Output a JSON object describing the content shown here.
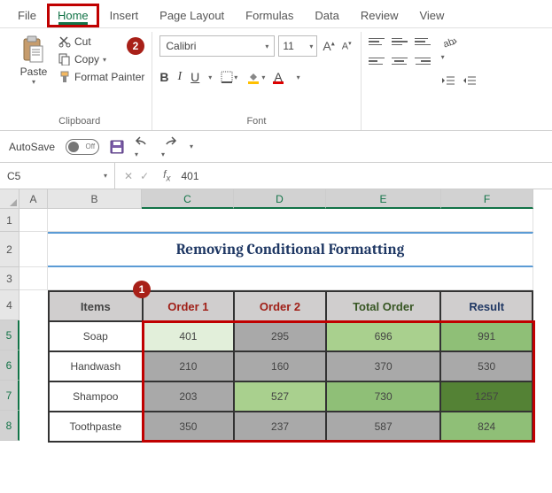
{
  "tabs": {
    "file": "File",
    "home": "Home",
    "insert": "Insert",
    "pagelayout": "Page Layout",
    "formulas": "Formulas",
    "data": "Data",
    "review": "Review",
    "view": "View"
  },
  "ribbon": {
    "clipboard": {
      "paste": "Paste",
      "cut": "Cut",
      "copy": "Copy",
      "painter": "Format Painter",
      "group": "Clipboard"
    },
    "font": {
      "name": "Calibri",
      "size": "11",
      "group": "Font"
    }
  },
  "autosave": {
    "label": "AutoSave",
    "state": "Off"
  },
  "namebox": "C5",
  "formula": "401",
  "badges": {
    "b1": "1",
    "b2": "2"
  },
  "cols": {
    "A": "A",
    "B": "B",
    "C": "C",
    "D": "D",
    "E": "E",
    "F": "F"
  },
  "rows": {
    "r1": "1",
    "r2": "2",
    "r3": "3",
    "r4": "4",
    "r5": "5",
    "r6": "6",
    "r7": "7",
    "r8": "8"
  },
  "title": "Removing Conditional Formatting",
  "headers": {
    "items": "Items",
    "o1": "Order 1",
    "o2": "Order 2",
    "tot": "Total Order",
    "res": "Result"
  },
  "data": {
    "r5": {
      "item": "Soap",
      "o1": "401",
      "o2": "295",
      "tot": "696",
      "res": "991"
    },
    "r6": {
      "item": "Handwash",
      "o1": "210",
      "o2": "160",
      "tot": "370",
      "res": "530"
    },
    "r7": {
      "item": "Shampoo",
      "o1": "203",
      "o2": "527",
      "tot": "730",
      "res": "1257"
    },
    "r8": {
      "item": "Toothpaste",
      "o1": "350",
      "o2": "237",
      "tot": "587",
      "res": "824"
    }
  },
  "colors": {
    "r5o1": "#e2efda",
    "r5o2": "#a9a9a9",
    "r5tot": "#a9d08e",
    "r5res": "#8fbf77",
    "r6o1": "#a9a9a9",
    "r6o2": "#a9a9a9",
    "r6tot": "#a9a9a9",
    "r6res": "#a9a9a9",
    "r7o1": "#a9a9a9",
    "r7o2": "#a9d08e",
    "r7tot": "#8fbf77",
    "r7res": "#548235",
    "r8o1": "#a9a9a9",
    "r8o2": "#a9a9a9",
    "r8tot": "#a9a9a9",
    "r8res": "#8fbf77"
  }
}
